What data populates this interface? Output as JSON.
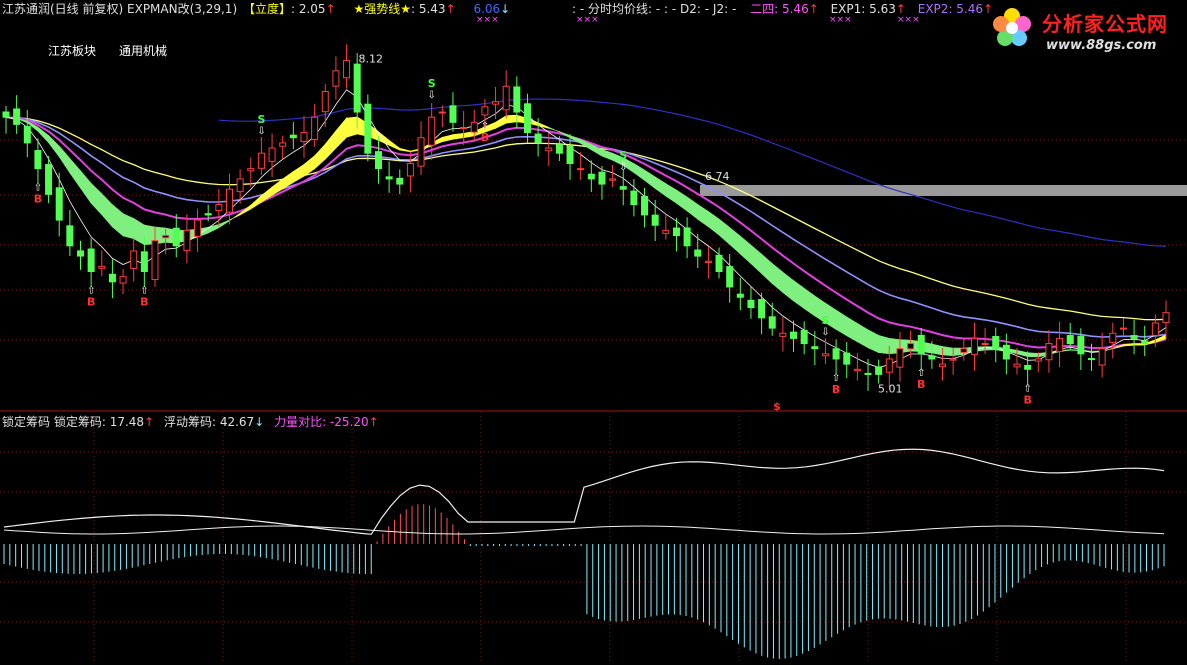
{
  "header": {
    "stock_title": "江苏通润(日线 前复权)",
    "formula": "EXPMAN改(3,29,1)",
    "lidu_label": "【立度】",
    "lidu_value": ": 2.05",
    "qiangshi_label": "★强势线★",
    "qiangshi_value": ": 5.43",
    "extra_value": "6.06",
    "fenshi_label": ": - 分时均价线: -",
    "d2_label": ": - D2: - J2: -",
    "ersi_label": "二四",
    "ersi_value": ": 5.46",
    "exp1_label": "EXP1",
    "exp1_value": ": 5.63",
    "exp2_label": "EXP2",
    "exp2_value": ": 5.46",
    "marks": "×××"
  },
  "tags": {
    "sector": "江苏板块",
    "industry": "通用机械"
  },
  "logo": {
    "brand": "分析家公式网",
    "url": "www.88gs.com"
  },
  "indicator_header": {
    "label_prefix": "锁定筹码",
    "locked_label": "锁定筹码",
    "locked_value": ": 17.48",
    "floating_label": "浮动筹码",
    "floating_value": ": 42.67",
    "ratio_label": "力量对比",
    "ratio_value": ": -25.20"
  },
  "colors": {
    "up": "#ff3c3c",
    "down": "#54ff54",
    "yellow_band": "#ffff40",
    "green_band": "#7ff07f",
    "magenta": "#e040e0",
    "lavender": "#9090ff",
    "long_ma": "#ffff80",
    "blue_ma": "#3030c0",
    "cyan_bar": "#80f0ff",
    "red_bar": "#ff5050"
  },
  "chart_data": {
    "type": "candlestick",
    "price_annotations": {
      "high": "8.12",
      "low": "5.01",
      "mid": "6.74"
    },
    "markers": [
      {
        "label": "B",
        "index": 3
      },
      {
        "label": "B",
        "index": 8
      },
      {
        "label": "B",
        "index": 13
      },
      {
        "label": "S",
        "index": 24
      },
      {
        "label": "S",
        "index": 40
      },
      {
        "label": "B",
        "index": 45
      },
      {
        "label": "S",
        "index": 58
      },
      {
        "label": "B",
        "index": 78
      },
      {
        "label": "B",
        "index": 86
      },
      {
        "label": "B",
        "index": 96
      },
      {
        "label": "S",
        "index": 77
      }
    ],
    "closes": [
      7.55,
      7.48,
      7.3,
      7.05,
      6.8,
      6.55,
      6.3,
      6.2,
      6.05,
      6.1,
      5.95,
      6.0,
      6.25,
      6.05,
      6.35,
      6.4,
      6.3,
      6.45,
      6.55,
      6.6,
      6.7,
      6.85,
      6.95,
      7.05,
      7.2,
      7.25,
      7.3,
      7.35,
      7.4,
      7.55,
      7.8,
      8.0,
      8.1,
      7.6,
      7.2,
      7.05,
      6.95,
      6.9,
      7.1,
      7.35,
      7.55,
      7.6,
      7.5,
      7.45,
      7.5,
      7.65,
      7.7,
      7.85,
      7.6,
      7.4,
      7.3,
      7.25,
      7.2,
      7.1,
      7.05,
      6.95,
      6.9,
      6.95,
      6.85,
      6.7,
      6.6,
      6.5,
      6.45,
      6.4,
      6.3,
      6.2,
      6.15,
      6.05,
      5.9,
      5.8,
      5.7,
      5.6,
      5.5,
      5.45,
      5.4,
      5.35,
      5.3,
      5.25,
      5.2,
      5.15,
      5.1,
      5.05,
      5.05,
      5.2,
      5.3,
      5.35,
      5.25,
      5.2,
      5.15,
      5.2,
      5.3,
      5.4,
      5.35,
      5.3,
      5.2,
      5.15,
      5.1,
      5.2,
      5.35,
      5.4,
      5.35,
      5.25,
      5.2,
      5.3,
      5.45,
      5.5,
      5.4,
      5.35,
      5.55,
      5.65
    ]
  }
}
